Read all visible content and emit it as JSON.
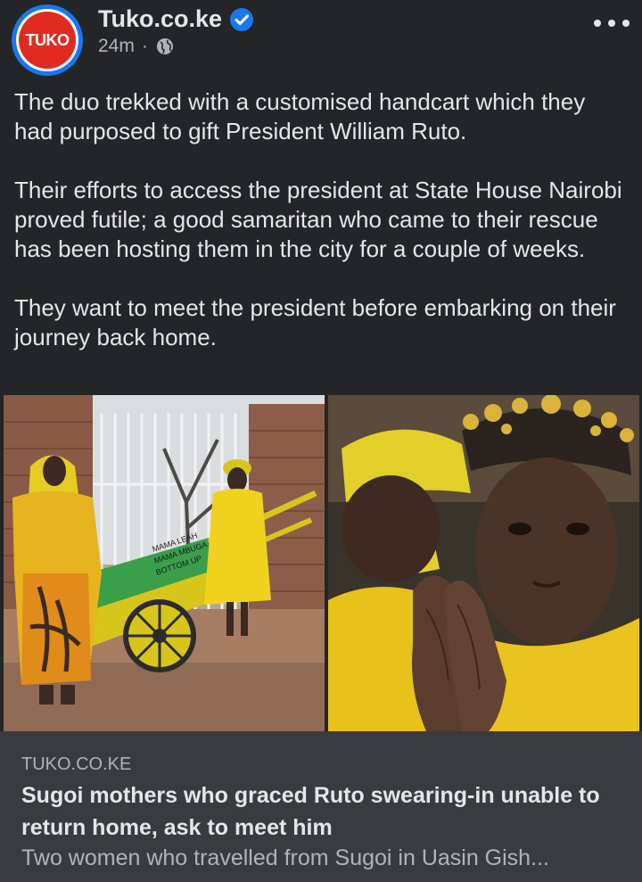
{
  "post": {
    "page_name": "Tuko.co.ke",
    "avatar_text": "TUKO",
    "time": "24m",
    "separator": "·",
    "paragraphs": [
      "The duo trekked with a customised handcart which they had purposed to gift President William Ruto.",
      "Their efforts to access the president at State House Nairobi proved futile; a good samaritan who came to their rescue has been hosting them in the city for a couple of weeks.",
      "They want to meet the president before embarking on their journey back home."
    ]
  },
  "cart_text": [
    "MAMA LEAH",
    "MAMA MBUGA",
    "BOTTOM UP"
  ],
  "link": {
    "domain": "TUKO.CO.KE",
    "title": "Sugoi mothers who graced Ruto swearing-in unable to return home, ask to meet him",
    "description": "Two women who travelled from Sugoi in Uasin Gish..."
  },
  "colors": {
    "background": "#242526",
    "card": "#3a3b3c",
    "text": "#e4e6eb",
    "secondary": "#b0b3b8",
    "accent": "#1877f2",
    "brand_red": "#e02b20"
  }
}
